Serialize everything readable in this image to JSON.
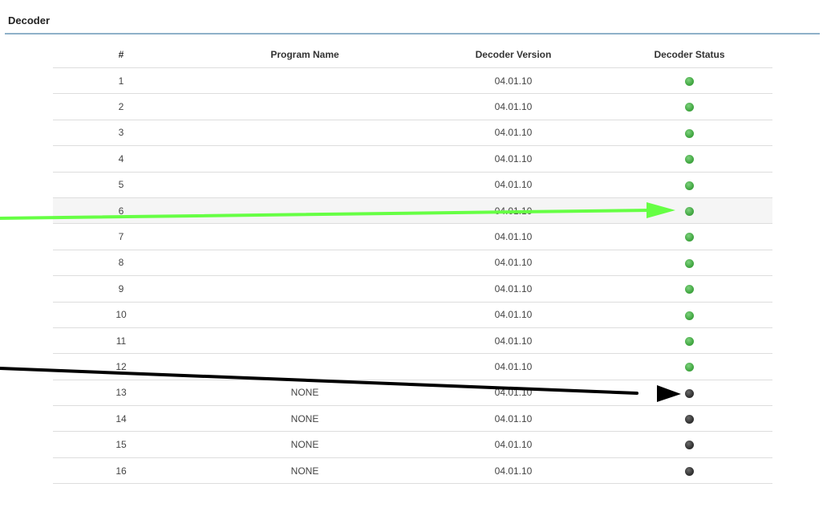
{
  "section": {
    "title": "Decoder"
  },
  "table": {
    "headers": [
      "#",
      "Program Name",
      "Decoder Version",
      "Decoder Status"
    ],
    "rows": [
      {
        "num": "1",
        "program": "",
        "version": "04.01.10",
        "status": "active"
      },
      {
        "num": "2",
        "program": "",
        "version": "04.01.10",
        "status": "active"
      },
      {
        "num": "3",
        "program": "",
        "version": "04.01.10",
        "status": "active"
      },
      {
        "num": "4",
        "program": "",
        "version": "04.01.10",
        "status": "active"
      },
      {
        "num": "5",
        "program": "",
        "version": "04.01.10",
        "status": "active"
      },
      {
        "num": "6",
        "program": "",
        "version": "04.01.10",
        "status": "active"
      },
      {
        "num": "7",
        "program": "",
        "version": "04.01.10",
        "status": "active"
      },
      {
        "num": "8",
        "program": "",
        "version": "04.01.10",
        "status": "active"
      },
      {
        "num": "9",
        "program": "",
        "version": "04.01.10",
        "status": "active"
      },
      {
        "num": "10",
        "program": "",
        "version": "04.01.10",
        "status": "active"
      },
      {
        "num": "11",
        "program": "",
        "version": "04.01.10",
        "status": "active"
      },
      {
        "num": "12",
        "program": "",
        "version": "04.01.10",
        "status": "active"
      },
      {
        "num": "13",
        "program": "NONE",
        "version": "04.01.10",
        "status": "inactive"
      },
      {
        "num": "14",
        "program": "NONE",
        "version": "04.01.10",
        "status": "inactive"
      },
      {
        "num": "15",
        "program": "NONE",
        "version": "04.01.10",
        "status": "inactive"
      },
      {
        "num": "16",
        "program": "NONE",
        "version": "04.01.10",
        "status": "inactive"
      }
    ]
  },
  "colors": {
    "status_active": "#43a843",
    "status_inactive": "#333333",
    "arrow_green": "#66ff44",
    "arrow_black": "#000000",
    "title_rule": "#8fb1c9"
  },
  "annotations": [
    {
      "name": "green-arrow",
      "points_to": "row 6 decoder status"
    },
    {
      "name": "black-arrow",
      "points_to": "row 13 decoder status"
    }
  ]
}
